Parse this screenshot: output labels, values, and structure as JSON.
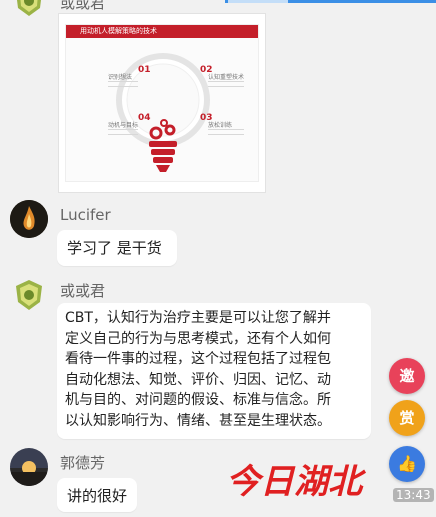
{
  "messages": [
    {
      "sender": "或或君",
      "type": "image",
      "image": {
        "title": "用动机人模解策略的技术",
        "numbers": [
          "01",
          "02",
          "03",
          "04"
        ],
        "labels": [
          "识别想法",
          "认知重塑技术",
          "动机与目标",
          "放松训练"
        ]
      }
    },
    {
      "sender": "Lucifer",
      "type": "text",
      "text": "学习了 是干货"
    },
    {
      "sender": "或或君",
      "type": "text",
      "lines": [
        "CBT，认知行为治疗主要是可以让您了解并",
        "定义自己的行为与思考模式，还有个人如何",
        "看待一件事的过程，这个过程包括了过程包",
        "自动化想法、知觉、评价、归因、记忆、动",
        "机与目的、对问题的假设、标准与信念。所",
        "以认知影响行为、情绪、甚至是生理状态。"
      ]
    },
    {
      "sender": "郭德芳",
      "type": "text",
      "text": "讲的很好"
    }
  ],
  "float_buttons": [
    {
      "label": "邀",
      "icon": "invite-icon",
      "color": "#e8425a"
    },
    {
      "label": "赏",
      "icon": "reward-icon",
      "color": "#f0a21a"
    },
    {
      "label": "👍",
      "icon": "like-icon",
      "color": "#3b7be0"
    }
  ],
  "watermark": {
    "text": "今日湖北"
  },
  "timestamp": "13:43"
}
